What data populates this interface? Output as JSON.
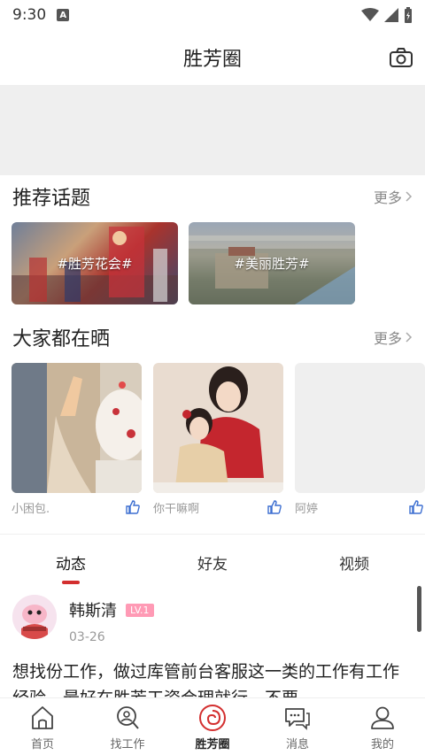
{
  "status": {
    "time": "9:30",
    "a_badge": "A"
  },
  "header": {
    "title": "胜芳圈"
  },
  "topics": {
    "title": "推荐话题",
    "more": "更多",
    "items": [
      {
        "label": "#胜芳花会#"
      },
      {
        "label": "#美丽胜芳#"
      }
    ]
  },
  "shares": {
    "title": "大家都在晒",
    "more": "更多",
    "items": [
      {
        "name": "小困包."
      },
      {
        "name": "你干嘛啊"
      },
      {
        "name": "阿婷"
      }
    ]
  },
  "tabs": [
    {
      "label": "动态"
    },
    {
      "label": "好友"
    },
    {
      "label": "视频"
    }
  ],
  "post": {
    "username": "韩斯清",
    "level": "LV.1",
    "date": "03-26",
    "text": "想找份工作，做过库管前台客服这一类的工作有工作经验，最好在胜芳工资合理就行。不要"
  },
  "bottom_nav": [
    {
      "label": "首页"
    },
    {
      "label": "找工作"
    },
    {
      "label": "胜芳圈"
    },
    {
      "label": "消息"
    },
    {
      "label": "我的"
    }
  ],
  "colors": {
    "accent": "#d32f2f",
    "badge": "#ff9ab5",
    "like": "#3d6fd1"
  }
}
